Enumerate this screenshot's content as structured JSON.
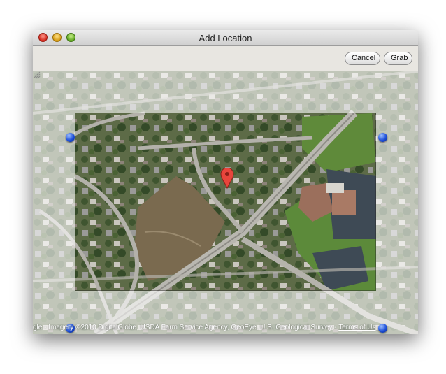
{
  "window": {
    "title": "Add Location",
    "controls": [
      "close",
      "minimize",
      "zoom"
    ]
  },
  "toolbar": {
    "cancel_label": "Cancel",
    "grab_label": "Grab"
  },
  "map": {
    "attribution_text": "gle - Imagery ©2010 DigitalGlobe, USDA Farm Service Agency, GeoEye, U.S. Geological Survey - ",
    "terms_label": "Terms of Us",
    "marker_icon": "map-pin-icon",
    "marker_color": "#e8453c",
    "handle_color": "#1e4fd8"
  }
}
